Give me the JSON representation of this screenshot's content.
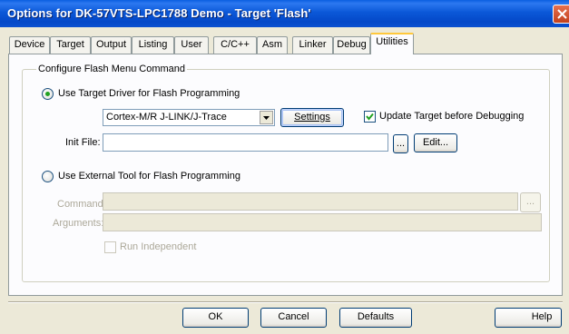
{
  "window": {
    "title": "Options for DK-57VTS-LPC1788 Demo - Target 'Flash'"
  },
  "tabs": [
    {
      "label": "Device"
    },
    {
      "label": "Target"
    },
    {
      "label": "Output"
    },
    {
      "label": "Listing"
    },
    {
      "label": "User"
    },
    {
      "label": "C/C++"
    },
    {
      "label": "Asm"
    },
    {
      "label": "Linker"
    },
    {
      "label": "Debug"
    },
    {
      "label": "Utilities"
    }
  ],
  "active_tab": "Utilities",
  "group": {
    "label": "Configure Flash Menu Command",
    "target_driver": {
      "label": "Use Target Driver for Flash Programming",
      "selected": true,
      "driver_value": "Cortex-M/R J-LINK/J-Trace",
      "settings_label": "Settings",
      "update_label": "Update Target before Debugging",
      "update_checked": true,
      "init_file_label": "Init File:",
      "init_file_value": "",
      "browse_label": "...",
      "edit_label": "Edit..."
    },
    "external_tool": {
      "label": "Use External Tool for Flash Programming",
      "selected": false,
      "command_label": "Command:",
      "command_value": "",
      "command_browse_label": "...",
      "arguments_label": "Arguments:",
      "arguments_value": "",
      "run_independent_label": "Run Independent",
      "run_independent_checked": false
    }
  },
  "footer": {
    "ok_label": "OK",
    "cancel_label": "Cancel",
    "defaults_label": "Defaults",
    "help_label": "Help"
  }
}
